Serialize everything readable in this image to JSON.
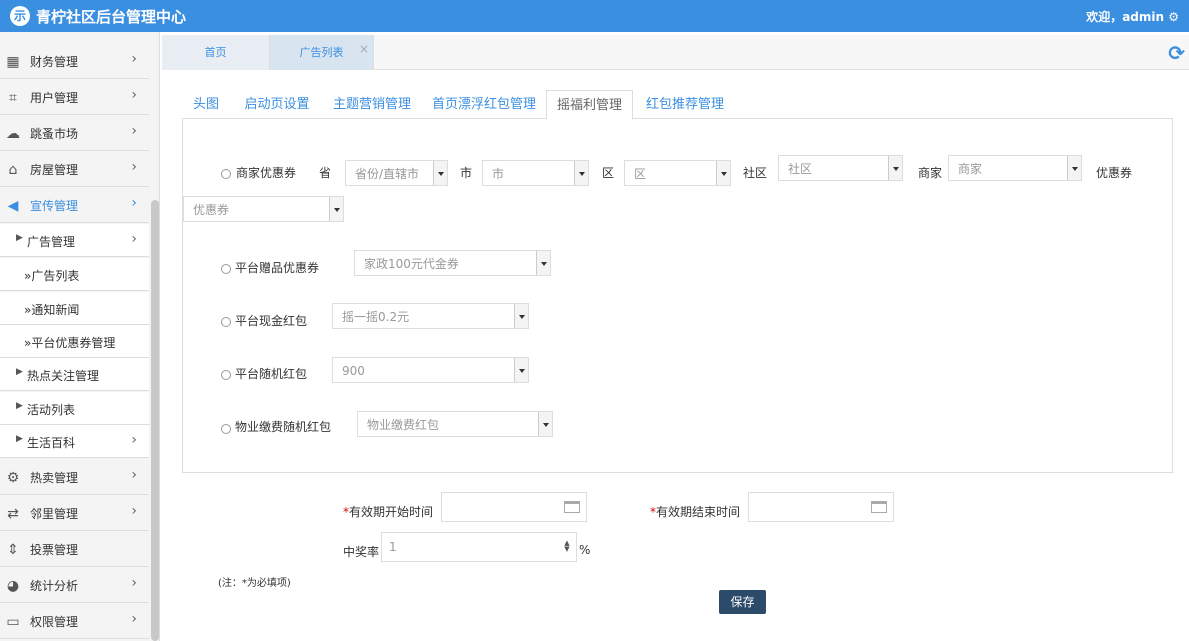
{
  "header": {
    "logo": "示",
    "title": "青柠社区后台管理中心",
    "welcome": "欢迎，admin",
    "welcome_icon": "gear-icon"
  },
  "sidebar": {
    "items": [
      {
        "label": "财务管理",
        "icon": "calculator-icon"
      },
      {
        "label": "用户管理",
        "icon": "crop-icon"
      },
      {
        "label": "跳蚤市场",
        "icon": "cloud-icon"
      },
      {
        "label": "房屋管理",
        "icon": "bank-icon"
      },
      {
        "label": "宣传管理",
        "icon": "megaphone-icon"
      },
      {
        "label": "广告管理"
      },
      {
        "label": "»广告列表"
      },
      {
        "label": "»通知新闻"
      },
      {
        "label": "»平台优惠券管理"
      },
      {
        "label": "热点关注管理"
      },
      {
        "label": "活动列表"
      },
      {
        "label": "生活百科"
      },
      {
        "label": "热卖管理",
        "icon": "gear-icon"
      },
      {
        "label": "邻里管理",
        "icon": "retweet-icon"
      },
      {
        "label": "投票管理",
        "icon": "sort-icon"
      },
      {
        "label": "统计分析",
        "icon": "pie-chart-icon"
      },
      {
        "label": "权限管理",
        "icon": "monitor-icon"
      }
    ]
  },
  "tabs": [
    {
      "label": "首页"
    },
    {
      "label": "广告列表",
      "close": "×"
    }
  ],
  "subtabs": [
    "头图",
    "启动页设置",
    "主题营销管理",
    "首页漂浮红包管理",
    "摇福利管理",
    "红包推荐管理"
  ],
  "form": {
    "merchant_coupon": {
      "label": "商家优惠券",
      "prov_label": "省",
      "prov": "省份/直辖市",
      "city_label": "市",
      "city": "市",
      "area_label": "区",
      "area": "区",
      "comm_label": "社区",
      "comm": "社区",
      "shop_label": "商家",
      "shop": "商家",
      "coupon_label": "优惠券",
      "coupon": "优惠券"
    },
    "platform_gift": {
      "label": "平台赠品优惠券",
      "value": "家政100元代金券"
    },
    "platform_cash": {
      "label": "平台现金红包",
      "value": "摇一摇0.2元"
    },
    "platform_random": {
      "label": "平台随机红包",
      "value": "900"
    },
    "property_random": {
      "label": "物业缴费随机红包",
      "value": "物业缴费红包"
    },
    "start_label": "有效期开始时间",
    "end_label": "有效期结束时间",
    "rate_label": "中奖率",
    "rate_value": "1",
    "rate_unit": "%",
    "required_mark": "*",
    "note": "(注：*为必填项)",
    "save": "保存"
  },
  "colors": {
    "accent": "#3b8fe0",
    "save_bg": "#2c4a6a"
  }
}
